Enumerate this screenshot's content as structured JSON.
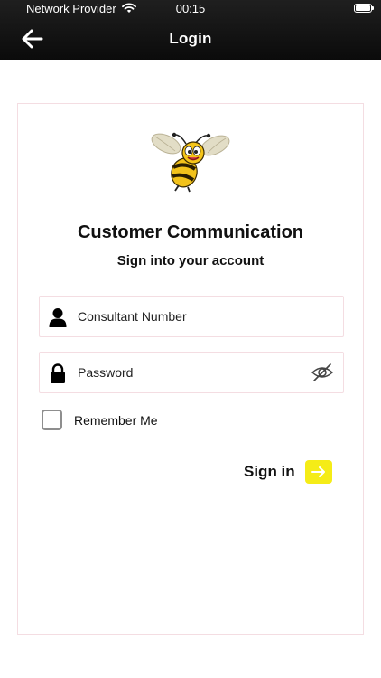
{
  "status_bar": {
    "carrier": "Network Provider",
    "time": "00:15"
  },
  "nav": {
    "title": "Login",
    "back_icon": "arrow-left-icon"
  },
  "card": {
    "logo_icon": "bee-mascot-logo",
    "title": "Customer Communication",
    "subtitle": "Sign into your account"
  },
  "form": {
    "username": {
      "placeholder": "Consultant Number",
      "value": "",
      "icon": "user-icon"
    },
    "password": {
      "placeholder": "Password",
      "value": "",
      "icon": "lock-icon",
      "toggle_icon": "eye-slash-icon"
    },
    "remember": {
      "label": "Remember Me",
      "checked": false
    },
    "submit": {
      "label": "Sign in",
      "icon": "arrow-right-icon"
    }
  },
  "colors": {
    "header_bg": "#111111",
    "accent_yellow": "#f5ec17",
    "card_border": "#f4dde2",
    "checkbox_border": "#8e8e8e"
  }
}
